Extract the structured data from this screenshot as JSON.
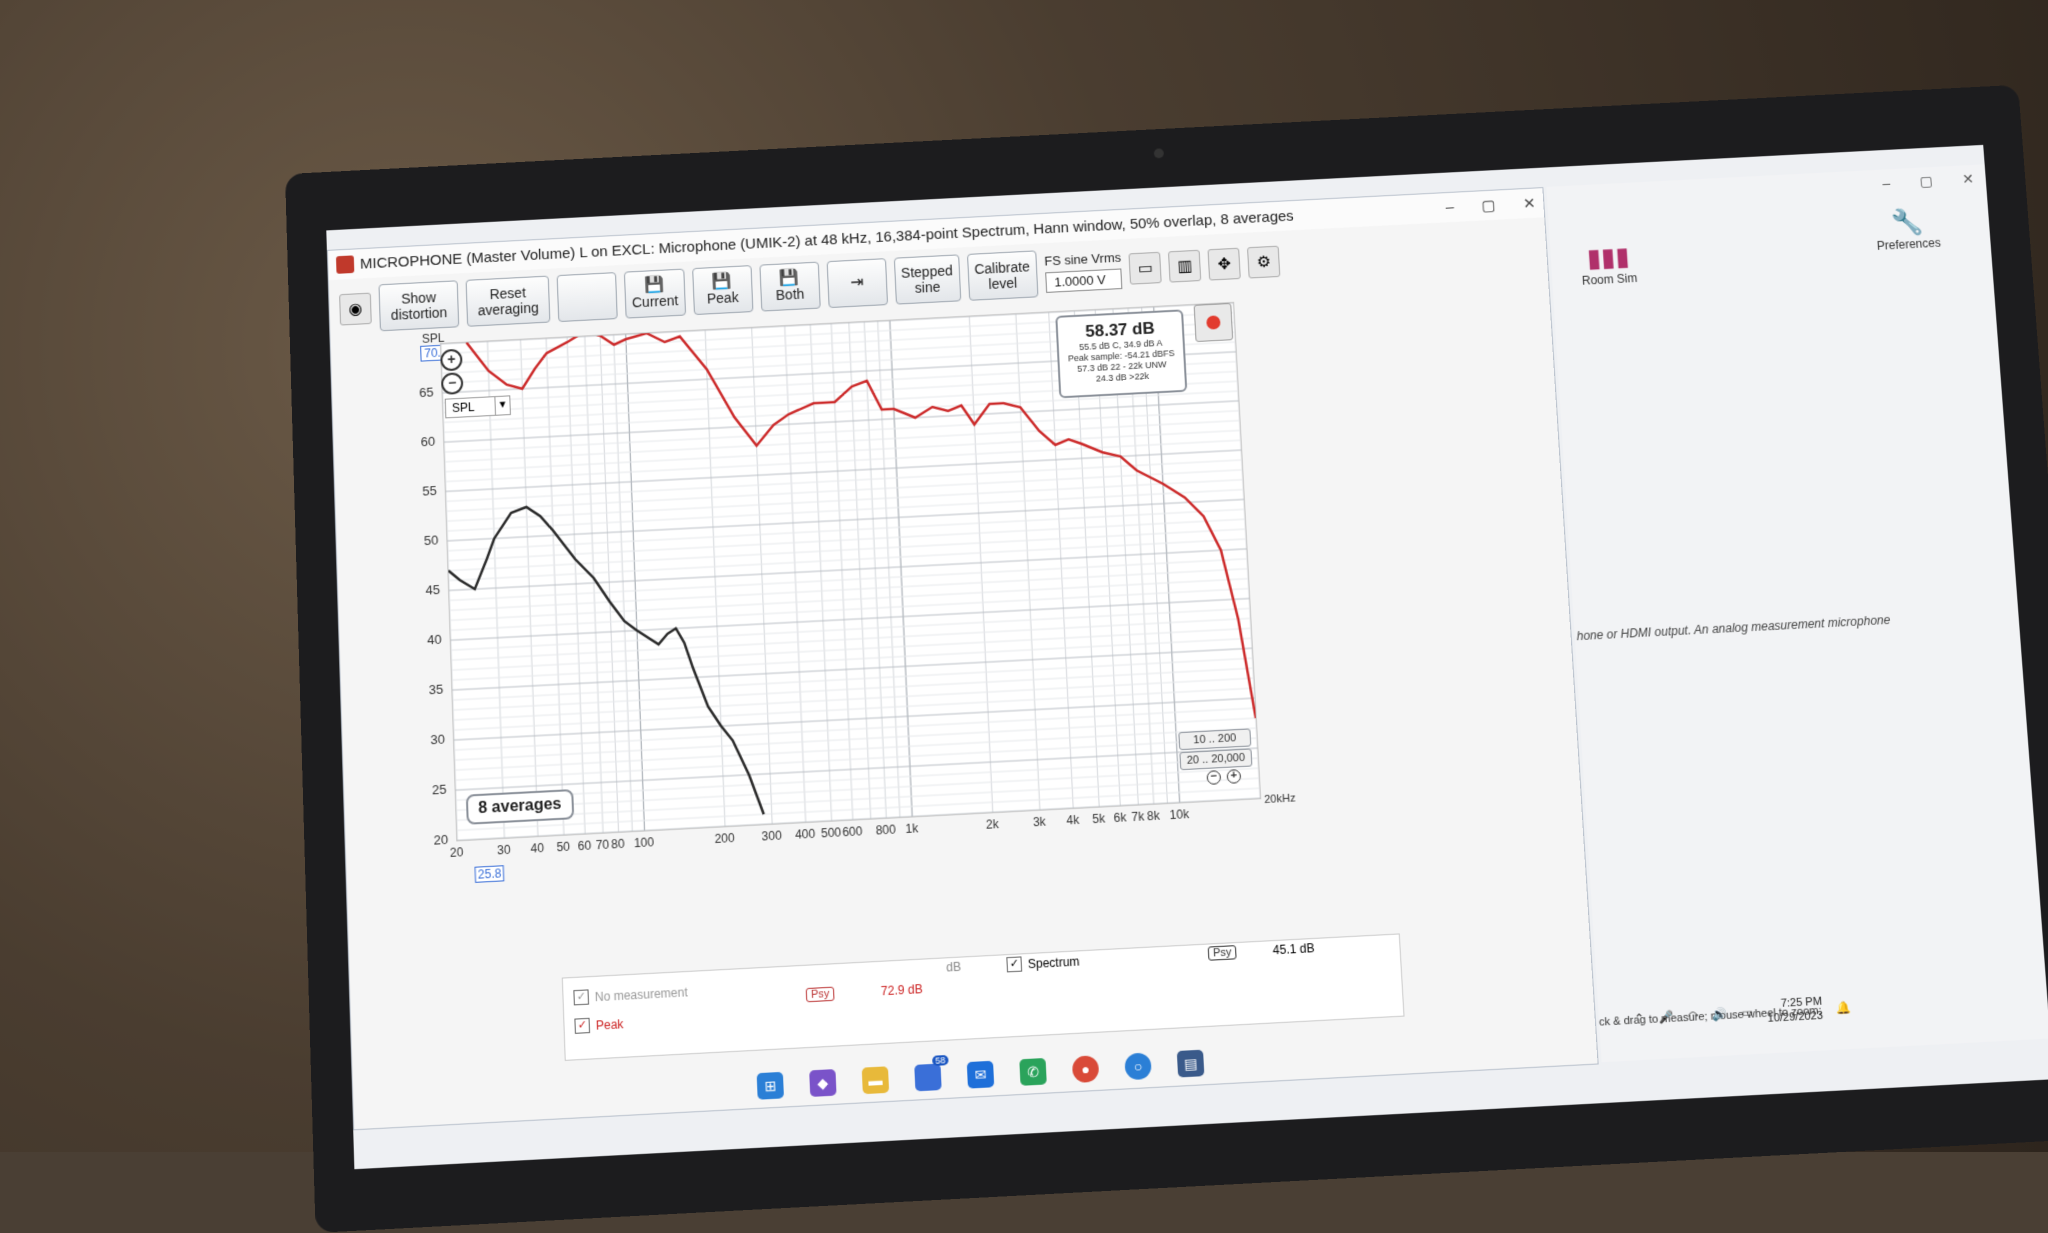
{
  "window": {
    "title": "MICROPHONE (Master Volume) L on EXCL: Microphone (UMIK-2) at 48 kHz, 16,384-point Spectrum, Hann window, 50% overlap, 8 averages",
    "controls": [
      "–",
      "▢",
      "✕"
    ]
  },
  "toolbar": {
    "show_distortion": "Show distortion",
    "reset_averaging": "Reset averaging",
    "current": "Current",
    "peak": "Peak",
    "both": "Both",
    "stepped_sine": "Stepped sine",
    "calibrate_level": "Calibrate level",
    "fs_label": "FS sine Vrms",
    "fs_value": "1.0000 V"
  },
  "plot": {
    "y_title": "SPL",
    "y_cursor": "70.5",
    "x_cursor": "25.8",
    "spl_select": "SPL",
    "averages_label": "8 averages",
    "range_buttons": [
      "10 .. 200",
      "20 .. 20,000"
    ],
    "khz_label": "20kHz"
  },
  "readout": {
    "main": "58.37 dB",
    "line1": "55.5 dB C, 34.9 dB A",
    "line2": "Peak sample: -54.21 dBFS",
    "line3": "57.3 dB 22 - 22k UNW",
    "line4": "24.3 dB >22k"
  },
  "legend": {
    "no_measurement": "No measurement",
    "peak": "Peak",
    "spectrum": "Spectrum",
    "db_label": "dB",
    "peak_value": "72.9 dB",
    "spectrum_value": "45.1 dB",
    "psy": "Psy"
  },
  "right_pane": {
    "room_sim": "Room Sim",
    "preferences": "Preferences",
    "hint": "hone or HDMI output. An analog measurement microphone",
    "status": "ck & drag to measure; mouse wheel to zoom;"
  },
  "clock": {
    "time": "7:25 PM",
    "date": "10/29/2023"
  },
  "taskbar": {
    "badge": "58"
  },
  "chart_data": {
    "type": "line",
    "xlabel": "",
    "ylabel": "SPL",
    "x_scale": "log",
    "xlim": [
      20,
      20000
    ],
    "ylim": [
      20,
      70
    ],
    "y_ticks": [
      20,
      25,
      30,
      35,
      40,
      45,
      50,
      55,
      60,
      65
    ],
    "x_ticks": [
      "20",
      "30",
      "40",
      "50",
      "60",
      "70",
      "80",
      "100",
      "200",
      "300",
      "400",
      "500",
      "600",
      "800",
      "1k",
      "2k",
      "3k",
      "4k",
      "5k",
      "6k",
      "7k",
      "8k",
      "10k"
    ],
    "x_tick_values": [
      20,
      30,
      40,
      50,
      60,
      70,
      80,
      100,
      200,
      300,
      400,
      500,
      600,
      800,
      1000,
      2000,
      3000,
      4000,
      5000,
      6000,
      7000,
      8000,
      10000
    ],
    "series": [
      {
        "name": "Peak",
        "color": "#cc2a2a",
        "x": [
          25,
          30,
          35,
          40,
          45,
          50,
          60,
          70,
          80,
          90,
          100,
          120,
          140,
          160,
          200,
          250,
          300,
          350,
          400,
          500,
          600,
          700,
          800,
          900,
          1000,
          1200,
          1400,
          1600,
          1800,
          2000,
          2300,
          2600,
          3000,
          3500,
          4000,
          4500,
          5000,
          6000,
          7000,
          8000,
          10000,
          12000,
          14000,
          16000,
          18000,
          20000
        ],
        "y": [
          70,
          67,
          65.5,
          65,
          67,
          68.5,
          69.5,
          70.5,
          70,
          69,
          69.5,
          70,
          69,
          69.5,
          66,
          61,
          58,
          60,
          61,
          62,
          62,
          63.5,
          64,
          61,
          61,
          60,
          61,
          60.5,
          61,
          59,
          61,
          61,
          60.5,
          58,
          56.5,
          57,
          56.5,
          55.5,
          55,
          53.5,
          52,
          50.5,
          48.5,
          45,
          38,
          28
        ]
      },
      {
        "name": "Spectrum",
        "color": "#2a2a2a",
        "x": [
          20,
          22,
          25,
          28,
          30,
          35,
          40,
          45,
          50,
          60,
          70,
          80,
          90,
          100,
          120,
          130,
          140,
          150,
          160,
          180,
          200,
          220,
          250,
          280
        ],
        "y": [
          47,
          46,
          45,
          48,
          50,
          52.5,
          53,
          52,
          50.5,
          47.5,
          45.5,
          43,
          41,
          40,
          38.5,
          39.5,
          40,
          38.5,
          36,
          32,
          30,
          28.5,
          25,
          21
        ]
      }
    ]
  }
}
